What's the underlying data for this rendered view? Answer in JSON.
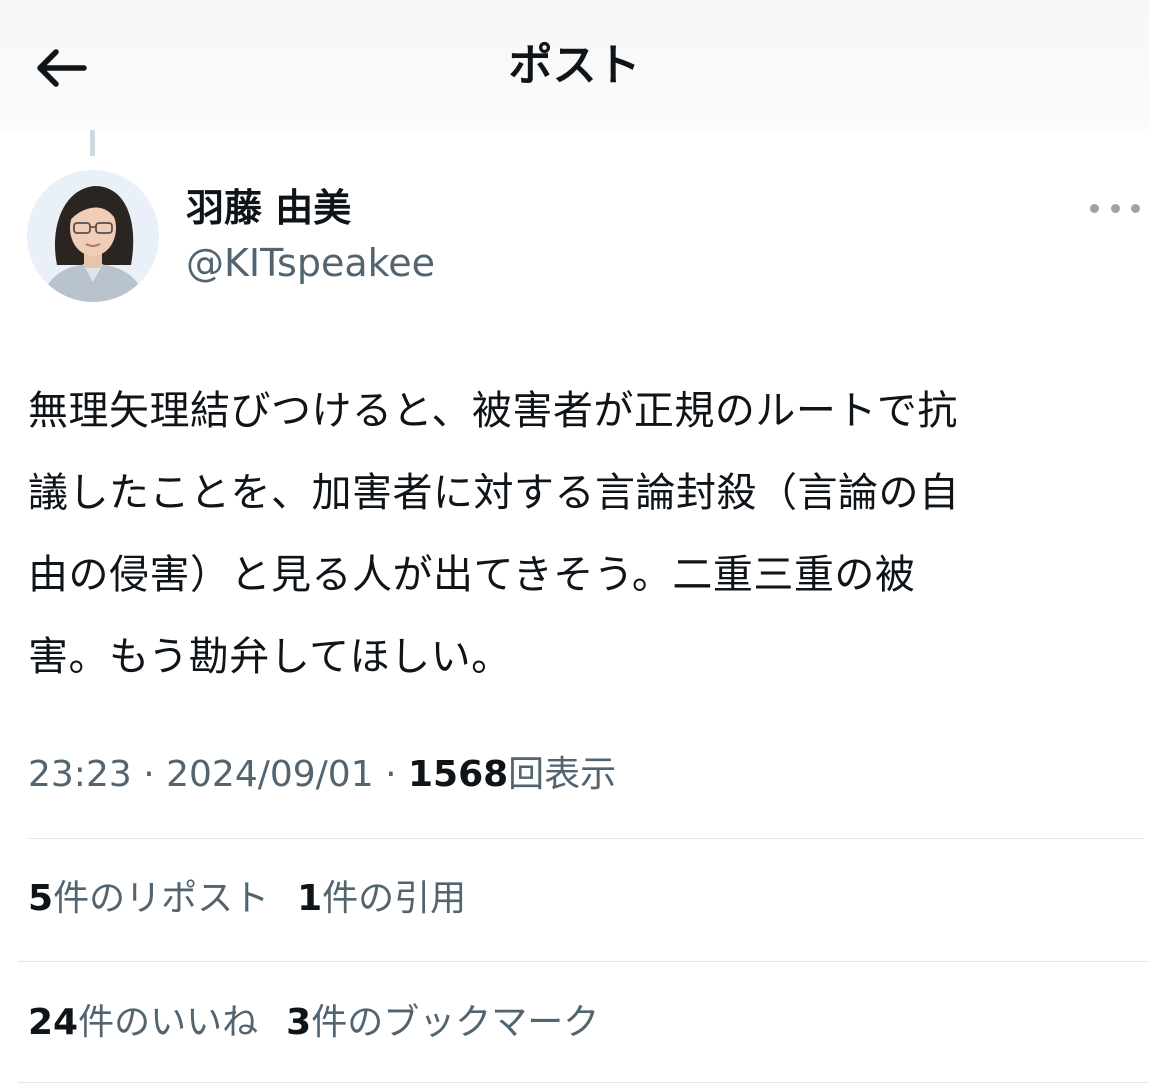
{
  "header": {
    "title": "ポスト",
    "back_icon": "arrow-left-icon"
  },
  "author": {
    "display_name": "羽藤 由美",
    "handle": "@KITspeakee"
  },
  "post": {
    "lines": [
      "無理矢理結びつけると、被害者が正規のルートで抗",
      "議したことを、加害者に対する言論封殺（言論の自",
      "由の侵害）と見る人が出てきそう。二重三重の被",
      "害。もう勘弁してほしい。"
    ],
    "time": "23:23",
    "date": "2024/09/01",
    "separator": "·",
    "views_count": "1568",
    "views_label": "回表示"
  },
  "stats": {
    "reposts_count": "5",
    "reposts_label": "件のリポスト",
    "quotes_count": "1",
    "quotes_label": "件の引用",
    "likes_count": "24",
    "likes_label": "件のいいね",
    "bookmarks_count": "3",
    "bookmarks_label": "件のブックマーク"
  },
  "colors": {
    "text": "#0f1419",
    "secondary_text": "#536471",
    "divider": "#e1e6ea"
  }
}
